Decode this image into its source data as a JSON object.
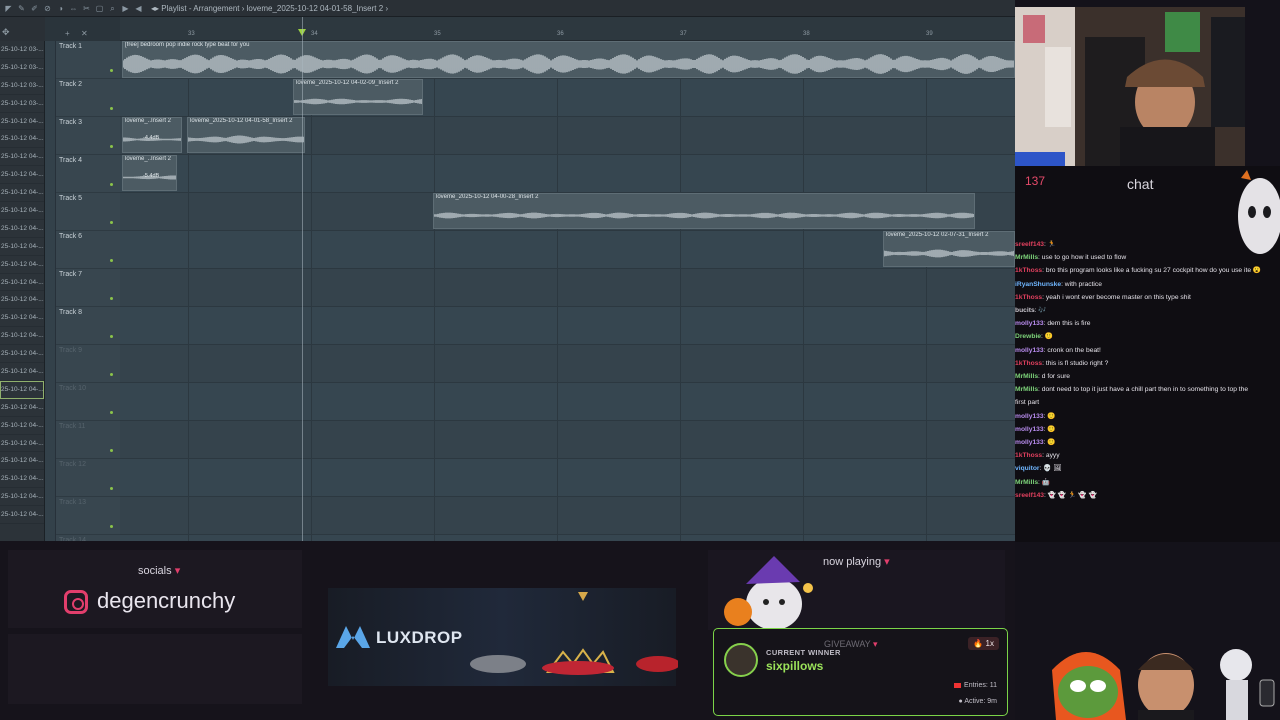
{
  "fl": {
    "breadcrumb": "Playlist - Arrangement",
    "current_clip": "loveme_2025-10-12 04-01-58_Insert 2",
    "ruler_ticks": [
      "33",
      "34",
      "35",
      "36",
      "37",
      "38",
      "39"
    ],
    "browser_items": [
      "25-10-12 03-...",
      "25-10-12 03-...",
      "25-10-12 03-...",
      "25-10-12 03-...",
      "25-10-12 04-...",
      "25-10-12 04-...",
      "25-10-12 04-...",
      "25-10-12 04-...",
      "25-10-12 04-...",
      "25-10-12 04-...",
      "25-10-12 04-...",
      "25-10-12 04-...",
      "25-10-12 04-...",
      "25-10-12 04-...",
      "25-10-12 04-...",
      "25-10-12 04-...",
      "25-10-12 04-...",
      "25-10-12 04-...",
      "25-10-12 04-...",
      "25-10-12 04-...",
      "25-10-12 04-...",
      "25-10-12 04-...",
      "25-10-12 04-...",
      "25-10-12 04-...",
      "25-10-12 04-...",
      "25-10-12 04-...",
      "25-10-12 04-..."
    ],
    "tracks": [
      "Track 1",
      "Track 2",
      "Track 3",
      "Track 4",
      "Track 5",
      "Track 6",
      "Track 7",
      "Track 8",
      "Track 9",
      "Track 10",
      "Track 11",
      "Track 12",
      "Track 13",
      "Track 14"
    ],
    "clips": {
      "c1": "[free] bedroom pop  indie rock type beat for you",
      "c2": "loveme_2025-10-12 04-02-09_Insert 2",
      "c3a": "loveme_..Insert 2",
      "c3b": "loveme_2025-10-12 04-01-58_Insert 2",
      "c3a_gain": "-4.4dB",
      "c4": "loveme_..Insert 2",
      "c4_gain": "-5.4dB",
      "c5": "loveme_2025-10-12 04-00-28_Insert 2",
      "c6": "loveme_2025-10-12 02-07-31_Insert 2"
    }
  },
  "chat": {
    "viewer_count": "137",
    "title": "chat",
    "messages": [
      {
        "user": "sreelf143",
        "text": ": 🏃",
        "color": "#e0405e"
      },
      {
        "user": "MrMills",
        "text": ": use to go how it used to flow",
        "color": "#7dd37a"
      },
      {
        "user": "1kThoss",
        "text": ": bro this program looks like a fucking su 27 cockpit how do you use ite 😮",
        "color": "#e0405e"
      },
      {
        "user": "iRyanShunske",
        "text": ": with practice",
        "color": "#6fb6ff"
      },
      {
        "user": "1kThoss",
        "text": ": yeah i wont ever become master on this type shit",
        "color": "#e0405e"
      },
      {
        "user": "bucits",
        "text": ": 🎶",
        "color": "#c9c6ce"
      },
      {
        "user": "molly133",
        "text": ": dem this is fire",
        "color": "#b98df0"
      },
      {
        "user": "Drewbie",
        "text": ": 🙂",
        "color": "#7dd37a"
      },
      {
        "user": "molly133",
        "text": ": cronk on the beat!",
        "color": "#b98df0"
      },
      {
        "user": "1kThoss",
        "text": ": this is fl studio right ?",
        "color": "#e0405e"
      },
      {
        "user": "MrMills",
        "text": ": d for sure",
        "color": "#7dd37a"
      },
      {
        "user": "MrMills",
        "text": ": dont need to top it just have a chill part then in to something to top the",
        "color": "#7dd37a"
      },
      {
        "user": "",
        "text": "first part",
        "color": "#c9c6ce"
      },
      {
        "user": "molly133",
        "text": ": 🙂",
        "color": "#b98df0"
      },
      {
        "user": "molly133",
        "text": ": 🙂",
        "color": "#b98df0"
      },
      {
        "user": "molly133",
        "text": ": 🙂",
        "color": "#b98df0"
      },
      {
        "user": "1kThoss",
        "text": ": ayyy",
        "color": "#e0405e"
      },
      {
        "user": "viquitor",
        "text": ": 💀 🖼",
        "color": "#6fb6ff"
      },
      {
        "user": "MrMills",
        "text": ": 🤖",
        "color": "#7dd37a"
      },
      {
        "user": "sreelf143",
        "text": ": 👻 👻 🏃 👻 👻",
        "color": "#e0405e"
      }
    ]
  },
  "socials": {
    "title": "socials",
    "handle": "degencrunchy"
  },
  "sponsor": {
    "name": "LUXDROP"
  },
  "now_playing": {
    "title": "now playing"
  },
  "giveaway": {
    "label": "GIVEAWAY",
    "current_winner_label": "CURRENT WINNER",
    "winner": "sixpillows",
    "multiplier": "1x",
    "entries": "Entries: 11",
    "active": "Active: 9m"
  }
}
